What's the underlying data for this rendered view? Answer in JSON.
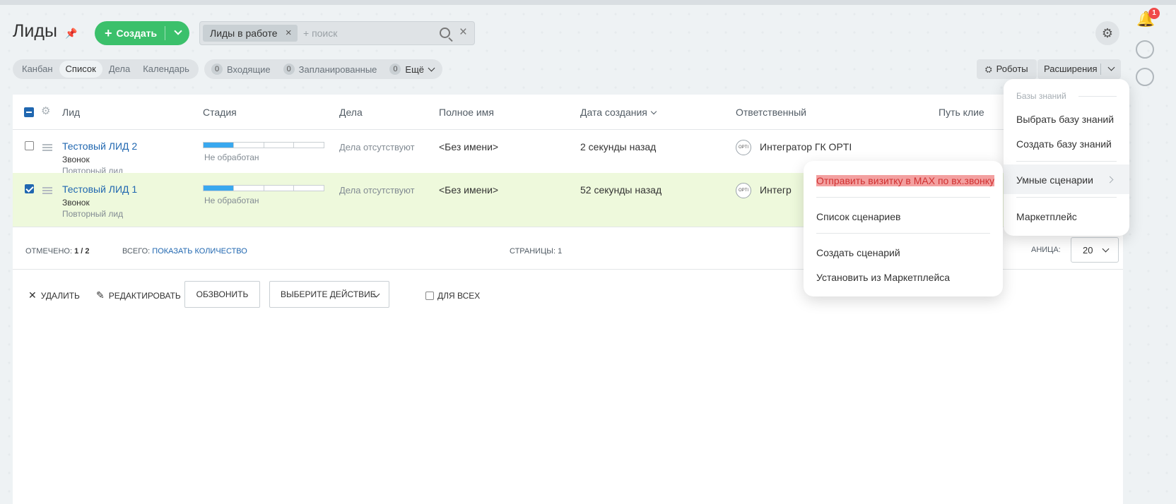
{
  "page": {
    "title": "Лиды"
  },
  "toolbar": {
    "create_label": "Создать"
  },
  "search": {
    "filter_chip": "Лиды в работе",
    "placeholder": "+ поиск"
  },
  "notifications": {
    "badge": "1"
  },
  "view_tabs": [
    {
      "label": "Канбан",
      "active": false
    },
    {
      "label": "Список",
      "active": true
    },
    {
      "label": "Дела",
      "active": false
    },
    {
      "label": "Календарь",
      "active": false
    }
  ],
  "counters": [
    {
      "count": "0",
      "label": "Входящие"
    },
    {
      "count": "0",
      "label": "Запланированные"
    },
    {
      "count": "0",
      "label": "Ещё"
    }
  ],
  "actions": {
    "robots_label": "Роботы",
    "extensions_label": "Расширения"
  },
  "grid": {
    "columns": [
      "Лид",
      "Стадия",
      "Дела",
      "Полное имя",
      "Дата создания",
      "Ответственный",
      "Путь клие"
    ],
    "rows": [
      {
        "title": "Тестовый ЛИД 2",
        "source": "Звонок",
        "type": "Повторный лид",
        "stage": "Не обработан",
        "stage_progress": 0.25,
        "deals": "Дела отсутствуют",
        "full_name": "<Без имени>",
        "created": "2 секунды назад",
        "responsible": "Интегратор ГК OPTI",
        "avatar_text": "OPTI",
        "checked": false
      },
      {
        "title": "Тестовый ЛИД 1",
        "source": "Звонок",
        "type": "Повторный лид",
        "stage": "Не обработан",
        "stage_progress": 0.25,
        "deals": "Дела отсутствуют",
        "full_name": "<Без имени>",
        "created": "52 секунды назад",
        "responsible": "Интегр",
        "avatar_text": "OPTI",
        "checked": true
      }
    ]
  },
  "footer": {
    "marked_label": "Отмечено:",
    "marked_value": "1 / 2",
    "total_label": "Всего:",
    "total_link": "Показать количество",
    "pages_label": "Страницы:",
    "pages_value": "1",
    "per_page_label": "аница:",
    "per_page_value": "20"
  },
  "bulk": {
    "delete": "Удалить",
    "edit": "Редактировать",
    "call": "Обзвонить",
    "select_action": "Выберите действие",
    "for_all": "Для всех"
  },
  "extensions_menu": {
    "section": "Базы знаний",
    "items": [
      "Выбрать базу знаний",
      "Создать базу знаний",
      "Умные сценарии",
      "Маркетплейс"
    ]
  },
  "scenarios_menu": {
    "items": [
      "Отправить визитку в MAX по вх.звонку",
      "Список сценариев",
      "Создать сценарий",
      "Установить из Маркетплейса"
    ]
  },
  "colors": {
    "accent": "#3bc06b",
    "link": "#2067b0",
    "stage": "#39a8ef",
    "selected_row": "#eef9dc",
    "badge": "#f04a4a"
  }
}
